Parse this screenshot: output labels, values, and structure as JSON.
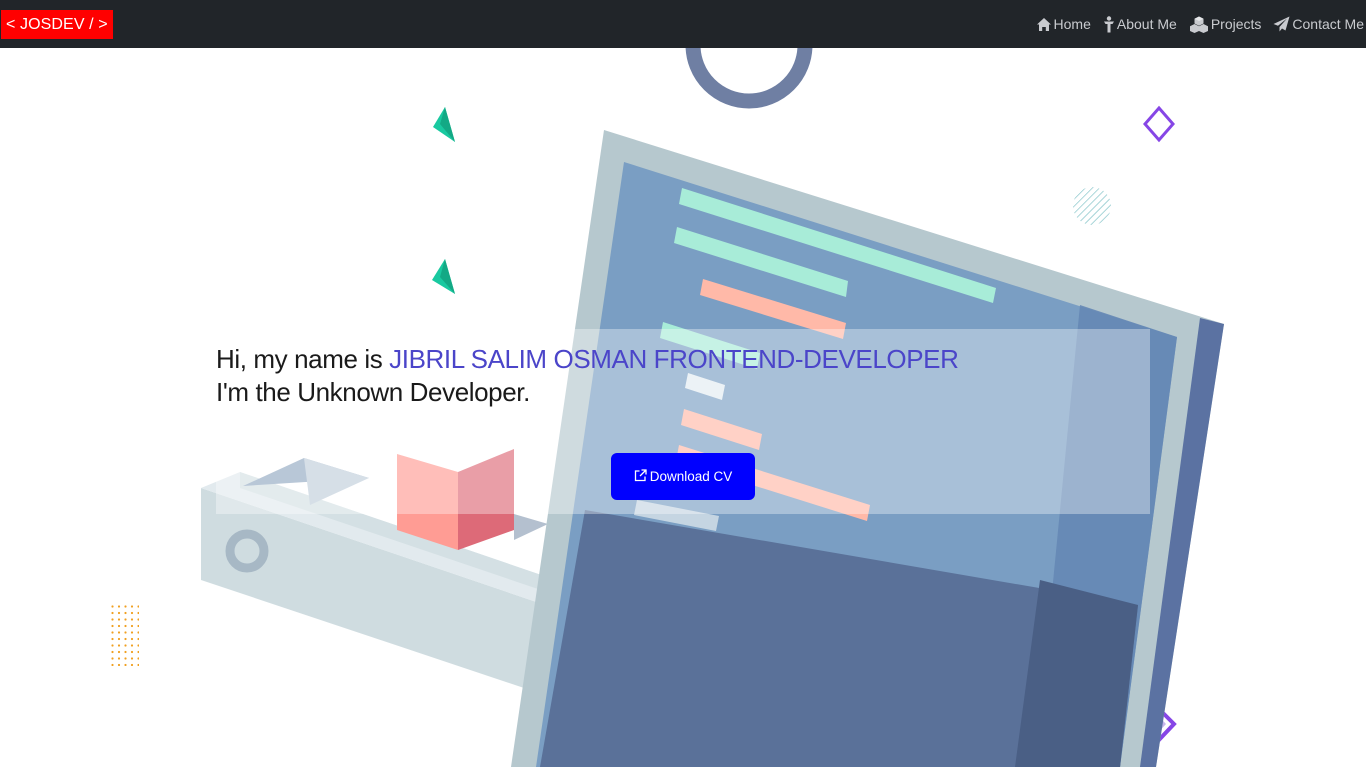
{
  "navbar": {
    "brand": "< JOSDEV / >",
    "links": [
      {
        "label": "Home",
        "icon": "home-icon"
      },
      {
        "label": "About Me",
        "icon": "person-icon"
      },
      {
        "label": "Projects",
        "icon": "cubes-icon"
      },
      {
        "label": "Contact Me",
        "icon": "paper-plane-icon"
      }
    ]
  },
  "hero": {
    "intro": "Hi, my name is",
    "name_role": "JIBRIL SALIM OSMAN FRONTEND-DEVELOPER",
    "tagline": "I'm the Unknown Developer.",
    "cta_label": "Download CV",
    "cta_icon": "external-link-icon"
  },
  "colors": {
    "navbar_bg": "#212529",
    "brand_bg": "#ff0000",
    "name_accent": "#4b45c9",
    "button_bg": "#0000ff"
  }
}
